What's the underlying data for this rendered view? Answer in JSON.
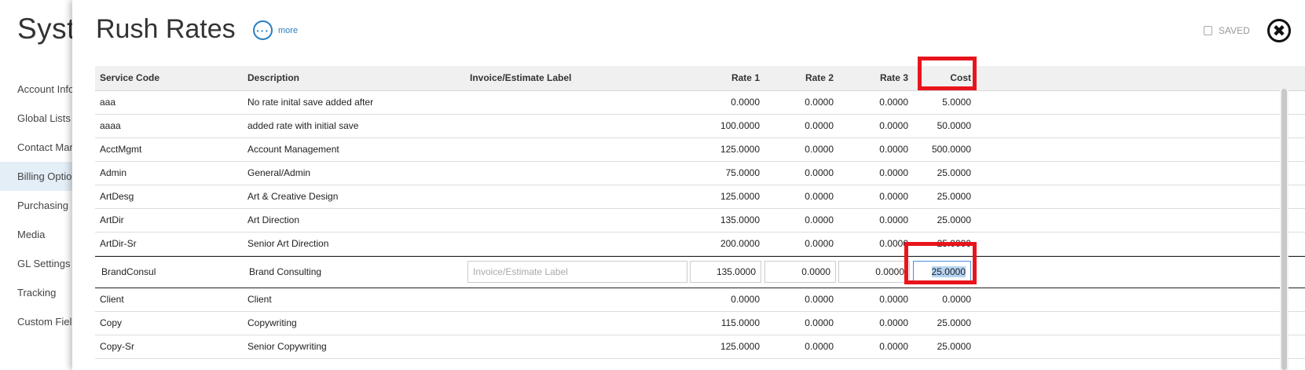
{
  "background": {
    "title": "Syste",
    "nav": [
      "Account Info",
      "Global Lists",
      "Contact Man",
      "Billing Options",
      "Purchasing",
      "Media",
      "GL Settings",
      "Tracking",
      "Custom Fields"
    ],
    "active_index": 3
  },
  "panel": {
    "title": "Rush Rates",
    "more_label": "more",
    "saved_label": "SAVED",
    "close_label": "✖"
  },
  "table": {
    "headers": {
      "code": "Service Code",
      "desc": "Description",
      "label": "Invoice/Estimate Label",
      "rate1": "Rate 1",
      "rate2": "Rate 2",
      "rate3": "Rate 3",
      "cost": "Cost"
    },
    "rows": [
      {
        "code": "aaa",
        "desc": "No rate inital save added after",
        "label": "",
        "rate1": "0.0000",
        "rate2": "0.0000",
        "rate3": "0.0000",
        "cost": "5.0000"
      },
      {
        "code": "aaaa",
        "desc": "added rate with initial save",
        "label": "",
        "rate1": "100.0000",
        "rate2": "0.0000",
        "rate3": "0.0000",
        "cost": "50.0000"
      },
      {
        "code": "AcctMgmt",
        "desc": "Account Management",
        "label": "",
        "rate1": "125.0000",
        "rate2": "0.0000",
        "rate3": "0.0000",
        "cost": "500.0000"
      },
      {
        "code": "Admin",
        "desc": "General/Admin",
        "label": "",
        "rate1": "75.0000",
        "rate2": "0.0000",
        "rate3": "0.0000",
        "cost": "25.0000"
      },
      {
        "code": "ArtDesg",
        "desc": "Art & Creative Design",
        "label": "",
        "rate1": "125.0000",
        "rate2": "0.0000",
        "rate3": "0.0000",
        "cost": "25.0000"
      },
      {
        "code": "ArtDir",
        "desc": "Art Direction",
        "label": "",
        "rate1": "135.0000",
        "rate2": "0.0000",
        "rate3": "0.0000",
        "cost": "25.0000"
      },
      {
        "code": "ArtDir-Sr",
        "desc": "Senior Art Direction",
        "label": "",
        "rate1": "200.0000",
        "rate2": "0.0000",
        "rate3": "0.0000",
        "cost": "25.0000"
      }
    ],
    "edit_row": {
      "code": "BrandConsul",
      "desc": "Brand Consulting",
      "label_placeholder": "Invoice/Estimate Label",
      "rate1": "135.0000",
      "rate2": "0.0000",
      "rate3": "0.0000",
      "cost": "25.0000"
    },
    "rows_after": [
      {
        "code": "Client",
        "desc": "Client",
        "label": "",
        "rate1": "0.0000",
        "rate2": "0.0000",
        "rate3": "0.0000",
        "cost": "0.0000"
      },
      {
        "code": "Copy",
        "desc": "Copywriting",
        "label": "",
        "rate1": "115.0000",
        "rate2": "0.0000",
        "rate3": "0.0000",
        "cost": "25.0000"
      },
      {
        "code": "Copy-Sr",
        "desc": "Senior Copywriting",
        "label": "",
        "rate1": "125.0000",
        "rate2": "0.0000",
        "rate3": "0.0000",
        "cost": "25.0000"
      }
    ]
  },
  "colors": {
    "highlight": "#e8141c",
    "accent": "#2a7fc1",
    "selection": "#b4d3f2"
  }
}
